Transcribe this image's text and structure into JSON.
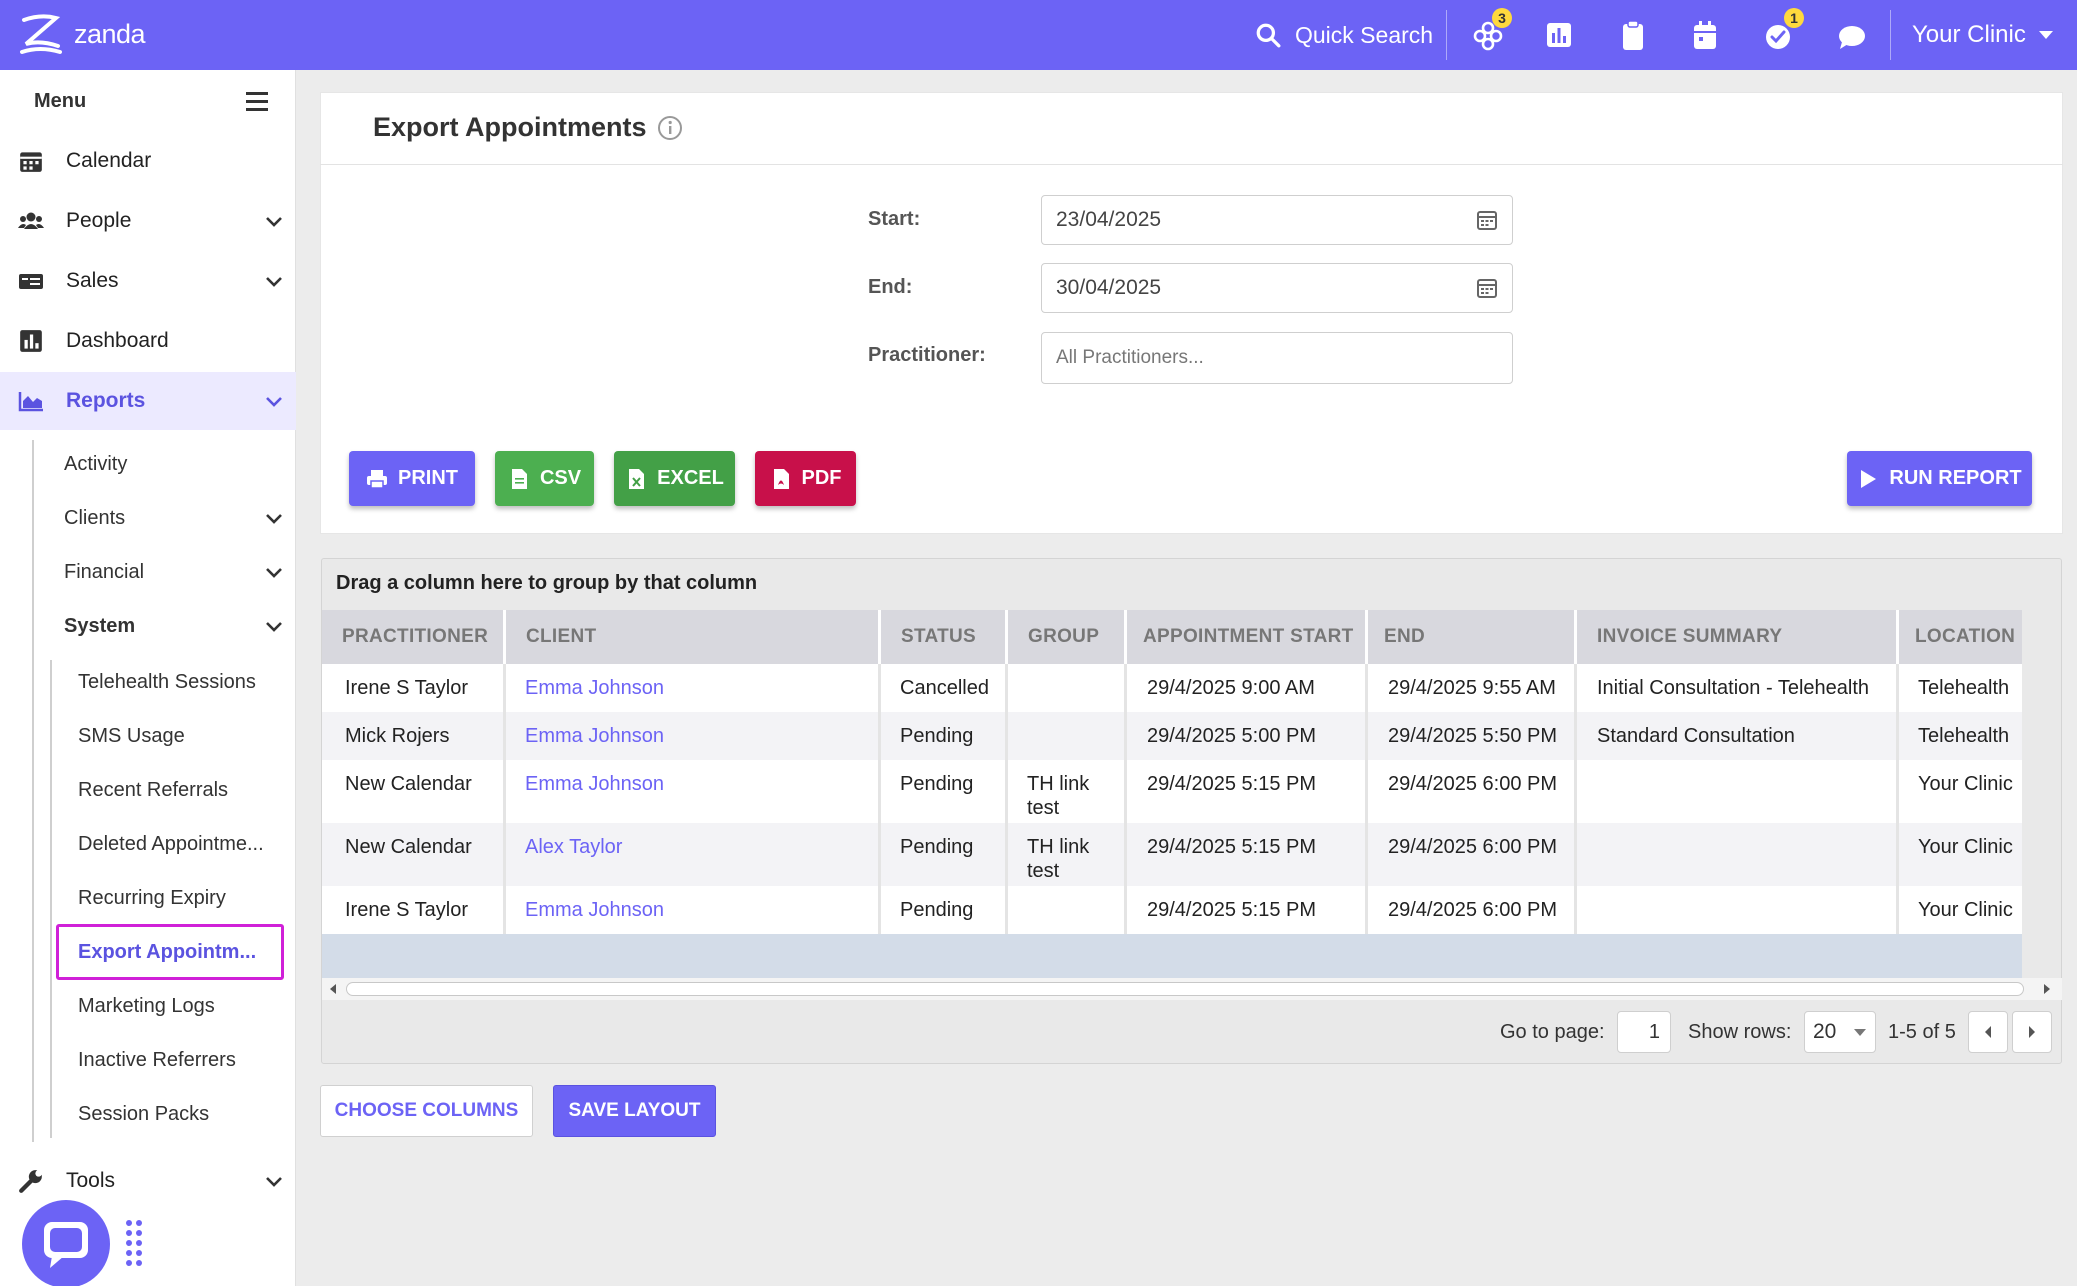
{
  "app": {
    "name": "zanda"
  },
  "topbar": {
    "quick_search": "Quick Search",
    "badge_apps": "3",
    "badge_tasks": "1",
    "clinic": "Your Clinic"
  },
  "sidebar": {
    "menu_label": "Menu",
    "items": {
      "calendar": "Calendar",
      "people": "People",
      "sales": "Sales",
      "dashboard": "Dashboard",
      "reports": "Reports",
      "tools": "Tools"
    },
    "reports_sub": {
      "activity": "Activity",
      "clients": "Clients",
      "financial": "Financial",
      "system": "System"
    },
    "system_sub": [
      "Telehealth Sessions",
      "SMS Usage",
      "Recent Referrals",
      "Deleted Appointme...",
      "Recurring Expiry",
      "Export Appointm...",
      "Marketing Logs",
      "Inactive Referrers",
      "Session Packs"
    ]
  },
  "page": {
    "title": "Export Appointments",
    "form": {
      "start_label": "Start:",
      "start_value": "23/04/2025",
      "end_label": "End:",
      "end_value": "30/04/2025",
      "practitioner_label": "Practitioner:",
      "practitioner_placeholder": "All Practitioners..."
    },
    "buttons": {
      "print": "PRINT",
      "csv": "CSV",
      "excel": "EXCEL",
      "pdf": "PDF",
      "run": "RUN REPORT"
    },
    "colors": {
      "print": "#6c63f5",
      "csv": "#4caf50",
      "excel": "#43a047",
      "pdf": "#c8104a",
      "run": "#6c63f5"
    }
  },
  "grid": {
    "group_hint": "Drag a column here to group by that column",
    "columns": [
      "PRACTITIONER",
      "CLIENT",
      "STATUS",
      "GROUP",
      "APPOINTMENT START",
      "END",
      "INVOICE SUMMARY",
      "LOCATION"
    ],
    "rows": [
      {
        "practitioner": "Irene S Taylor",
        "client": "Emma Johnson",
        "status": "Cancelled",
        "group": "",
        "start": "29/4/2025 9:00 AM",
        "end": "29/4/2025 9:55 AM",
        "invoice": "Initial Consultation - Telehealth",
        "location": "Telehealth"
      },
      {
        "practitioner": "Mick Rojers",
        "client": "Emma Johnson",
        "status": "Pending",
        "group": "",
        "start": "29/4/2025 5:00 PM",
        "end": "29/4/2025 5:50 PM",
        "invoice": "Standard Consultation",
        "location": "Telehealth"
      },
      {
        "practitioner": "New Calendar",
        "client": "Emma Johnson",
        "status": "Pending",
        "group": "TH link test",
        "start": "29/4/2025 5:15 PM",
        "end": "29/4/2025 6:00 PM",
        "invoice": "",
        "location": "Your Clinic"
      },
      {
        "practitioner": "New Calendar",
        "client": "Alex Taylor",
        "status": "Pending",
        "group": "TH link test",
        "start": "29/4/2025 5:15 PM",
        "end": "29/4/2025 6:00 PM",
        "invoice": "",
        "location": "Your Clinic"
      },
      {
        "practitioner": "Irene S Taylor",
        "client": "Emma Johnson",
        "status": "Pending",
        "group": "",
        "start": "29/4/2025 5:15 PM",
        "end": "29/4/2025 6:00 PM",
        "invoice": "",
        "location": "Your Clinic"
      }
    ],
    "pager": {
      "goto_label": "Go to page:",
      "page_value": "1",
      "rows_label": "Show rows:",
      "rows_value": "20",
      "range": "1-5 of 5"
    }
  },
  "footer": {
    "choose_columns": "CHOOSE COLUMNS",
    "save_layout": "SAVE LAYOUT"
  }
}
